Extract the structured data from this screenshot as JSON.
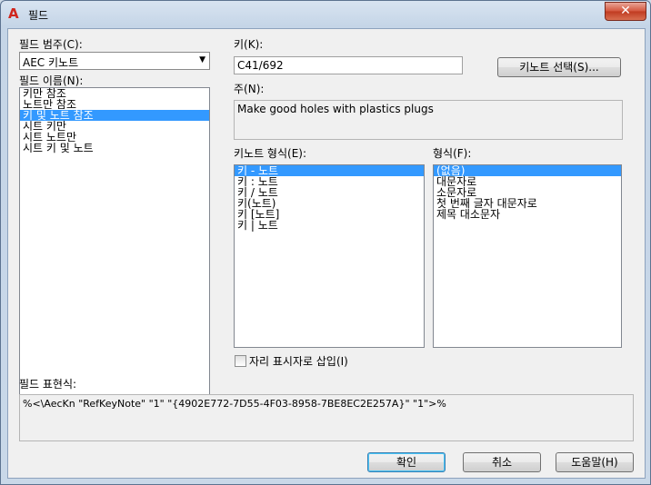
{
  "window": {
    "title": "필드",
    "app_icon": "A"
  },
  "category": {
    "label": "필드 범주(C):",
    "selected": "AEC 키노트"
  },
  "field_names": {
    "label": "필드 이름(N):",
    "items": [
      "키만 참조",
      "노트만 참조",
      "키 및 노트 참조",
      "시트 키만",
      "시트 노트만",
      "시트 키 및 노트"
    ],
    "selected_index": 2
  },
  "key": {
    "label": "키(K):",
    "value": "C41/692"
  },
  "select_keynote_button": "키노트 선택(S)...",
  "note": {
    "label": "주(N):",
    "value": "Make good holes with plastics plugs"
  },
  "keynote_format": {
    "label": "키노트 형식(E):",
    "items": [
      "키 - 노트",
      "키 : 노트",
      "키 / 노트",
      "키(노트)",
      "키 [노트]",
      "키 | 노트"
    ],
    "selected_index": 0
  },
  "format": {
    "label": "형식(F):",
    "items": [
      "(없음)",
      "대문자로",
      "소문자로",
      "첫 번째 글자 대문자로",
      "제목 대소문자"
    ],
    "selected_index": 0
  },
  "insert_placeholder": {
    "label": "자리 표시자로 삽입(I)",
    "checked": false
  },
  "field_expression": {
    "label": "필드 표현식:",
    "value": "%<\\AecKn \"RefKeyNote\" \"1\" \"{4902E772-7D55-4F03-8958-7BE8EC2E257A}\" \"1\">%"
  },
  "buttons": {
    "ok": "확인",
    "cancel": "취소",
    "help": "도움말(H)"
  },
  "icons": {
    "close": "close-icon",
    "dropdown": "chevron-down-icon",
    "app": "autocad-logo-icon"
  }
}
